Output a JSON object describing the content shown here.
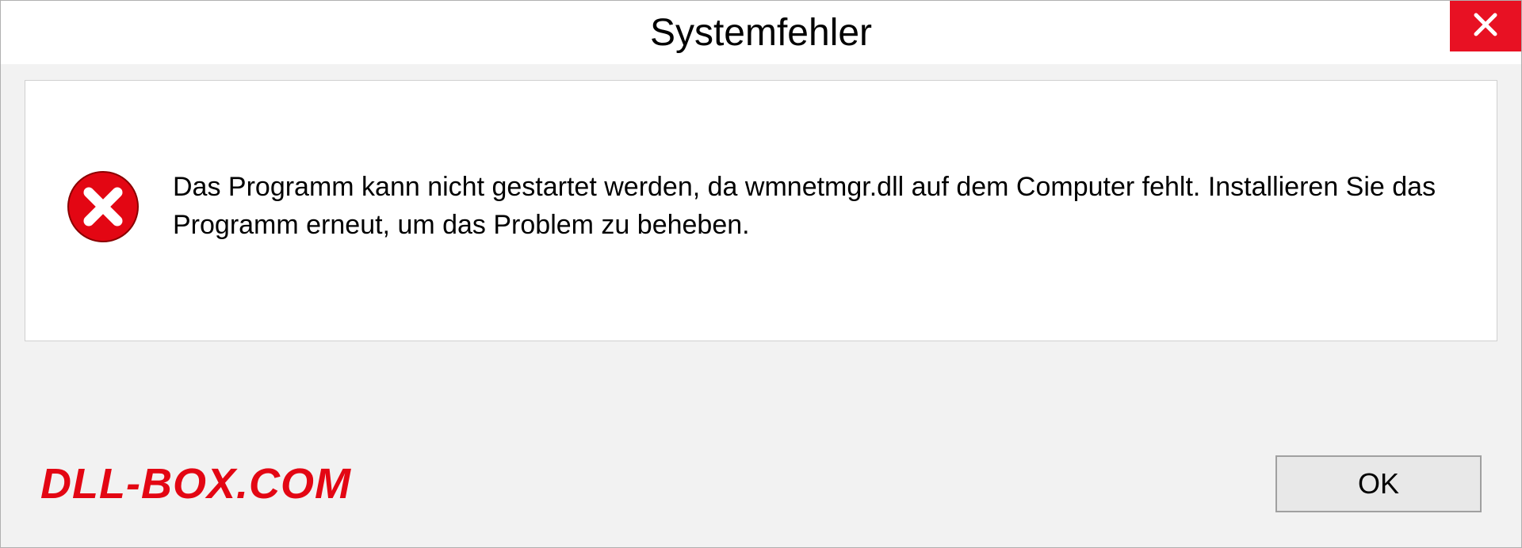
{
  "dialog": {
    "title": "Systemfehler",
    "message": "Das Programm kann nicht gestartet werden, da wmnetmgr.dll auf dem Computer fehlt. Installieren Sie das Programm erneut, um das Problem zu beheben.",
    "ok_label": "OK"
  },
  "watermark": "DLL-BOX.COM"
}
